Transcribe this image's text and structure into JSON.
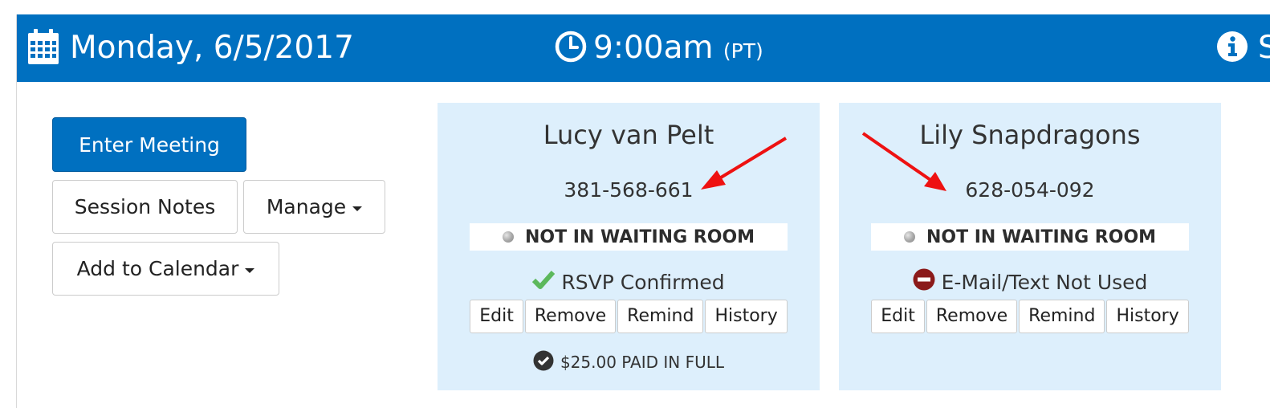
{
  "header": {
    "date_icon": "calendar-icon",
    "date": "Monday, 6/5/2017",
    "time_icon": "clock-icon",
    "time": "9:00am",
    "timezone": "(PT)",
    "info_icon": "info-circle-icon",
    "cut_text": "S",
    "background": "#0070c0"
  },
  "actions": {
    "enter_meeting": "Enter Meeting",
    "session_notes": "Session Notes",
    "manage": "Manage",
    "add_to_calendar": "Add to Calendar"
  },
  "participants": [
    {
      "name": "Lucy van Pelt",
      "phone": "381-568-661",
      "waiting_status": "NOT IN WAITING ROOM",
      "status_icon": "check-icon",
      "status_text": "RSVP Confirmed",
      "buttons": [
        "Edit",
        "Remove",
        "Remind",
        "History"
      ],
      "payment_icon": "check-circle-icon",
      "payment": "$25.00 PAID IN FULL"
    },
    {
      "name": "Lily Snapdragons",
      "phone": "628-054-092",
      "waiting_status": "NOT IN WAITING ROOM",
      "status_icon": "minus-circle-icon",
      "status_text": "E-Mail/Text Not Used",
      "buttons": [
        "Edit",
        "Remove",
        "Remind",
        "History"
      ]
    }
  ],
  "annotations": {
    "arrow_color": "#ee1111"
  },
  "colors": {
    "card_background": "#ddeffc",
    "check_green": "#5cb85c",
    "not_used_red": "#8b1a1a"
  }
}
